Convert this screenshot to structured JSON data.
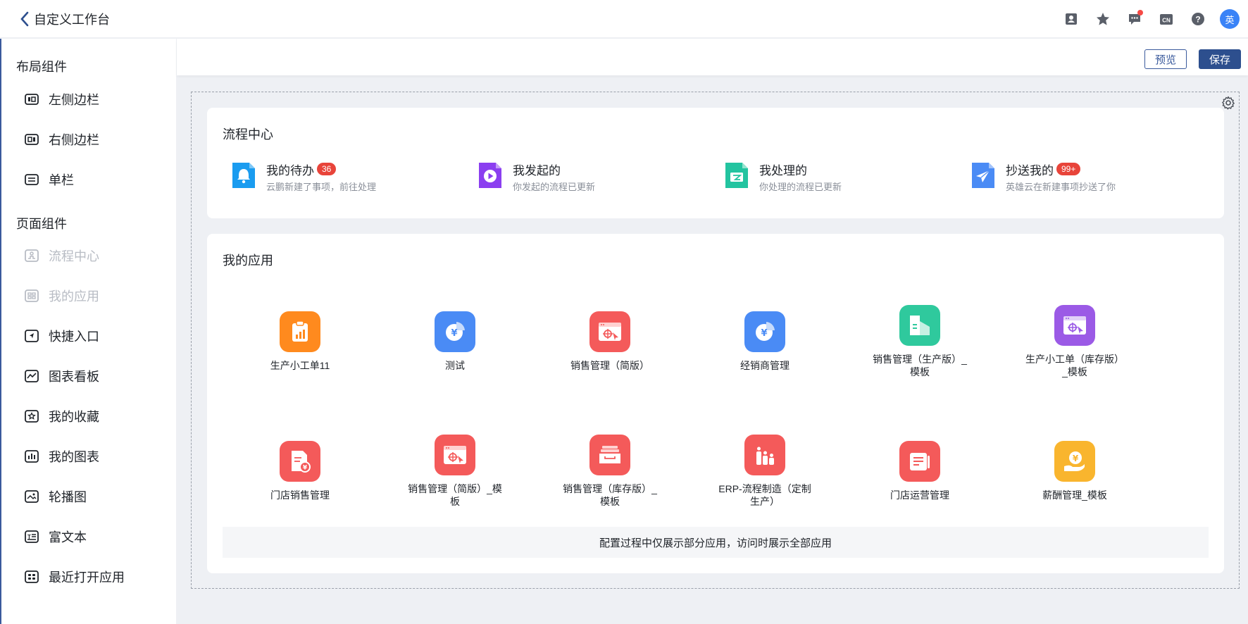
{
  "header": {
    "title": "自定义工作台",
    "avatar_text": "英",
    "icons": [
      "contacts-icon",
      "star-icon",
      "message-icon",
      "language-cn-icon",
      "help-icon"
    ],
    "lang_label": "CN"
  },
  "sidebar": {
    "layout_title": "布局组件",
    "layout_items": [
      {
        "label": "左侧边栏",
        "icon": "left-sidebar-icon"
      },
      {
        "label": "右侧边栏",
        "icon": "right-sidebar-icon"
      },
      {
        "label": "单栏",
        "icon": "single-column-icon"
      }
    ],
    "page_title": "页面组件",
    "page_items": [
      {
        "label": "流程中心",
        "icon": "flow-center-icon",
        "disabled": true
      },
      {
        "label": "我的应用",
        "icon": "my-apps-icon",
        "disabled": true
      },
      {
        "label": "快捷入口",
        "icon": "shortcut-icon",
        "disabled": false
      },
      {
        "label": "图表看板",
        "icon": "chart-board-icon",
        "disabled": false
      },
      {
        "label": "我的收藏",
        "icon": "favorites-icon",
        "disabled": false
      },
      {
        "label": "我的图表",
        "icon": "my-charts-icon",
        "disabled": false
      },
      {
        "label": "轮播图",
        "icon": "carousel-icon",
        "disabled": false
      },
      {
        "label": "富文本",
        "icon": "rich-text-icon",
        "disabled": false
      },
      {
        "label": "最近打开应用",
        "icon": "recent-apps-icon",
        "disabled": false
      }
    ]
  },
  "toolbar": {
    "preview_label": "预览",
    "save_label": "保存"
  },
  "flow_center": {
    "title": "流程中心",
    "items": [
      {
        "name": "我的待办",
        "badge": "36",
        "desc": "云鹏新建了事项，前往处理",
        "color": "#1a9cf0"
      },
      {
        "name": "我发起的",
        "badge": "",
        "desc": "你发起的流程已更新",
        "color": "#8b3ff0"
      },
      {
        "name": "我处理的",
        "badge": "",
        "desc": "你处理的流程已更新",
        "color": "#23c4a0"
      },
      {
        "name": "抄送我的",
        "badge": "99+",
        "desc": "英雄云在新建事项抄送了你",
        "color": "#4a8bf5"
      }
    ]
  },
  "my_apps": {
    "title": "我的应用",
    "apps": [
      {
        "name": "生产小工单11",
        "color": "#ff8a1e",
        "icon": "clipboard-chart-icon"
      },
      {
        "name": "测试",
        "color": "#4a8bf5",
        "icon": "yuan-pie-icon"
      },
      {
        "name": "销售管理（简版）",
        "color": "#f45a5a",
        "icon": "browser-target-icon"
      },
      {
        "name": "经销商管理",
        "color": "#4a8bf5",
        "icon": "yuan-pie-icon"
      },
      {
        "name": "销售管理（生产版）_模板",
        "color": "#2fc99d",
        "icon": "building-icon"
      },
      {
        "name": "生产小工单（库存版）_模板",
        "color": "#9b5ae6",
        "icon": "browser-target-icon"
      },
      {
        "name": "门店销售管理",
        "color": "#f45a5a",
        "icon": "document-yuan-icon"
      },
      {
        "name": "销售管理（简版）_模板",
        "color": "#f45a5a",
        "icon": "browser-target-icon"
      },
      {
        "name": "销售管理（库存版）_模板",
        "color": "#f45a5a",
        "icon": "inbox-tray-icon"
      },
      {
        "name": "ERP-流程制造（定制生产）",
        "color": "#f45a5a",
        "icon": "bottles-icon"
      },
      {
        "name": "门店运营管理",
        "color": "#f45a5a",
        "icon": "document-list-icon"
      },
      {
        "name": "薪酬管理_模板",
        "color": "#f9b52e",
        "icon": "hand-coin-icon"
      }
    ],
    "note": "配置过程中仅展示部分应用，访问时展示全部应用"
  }
}
